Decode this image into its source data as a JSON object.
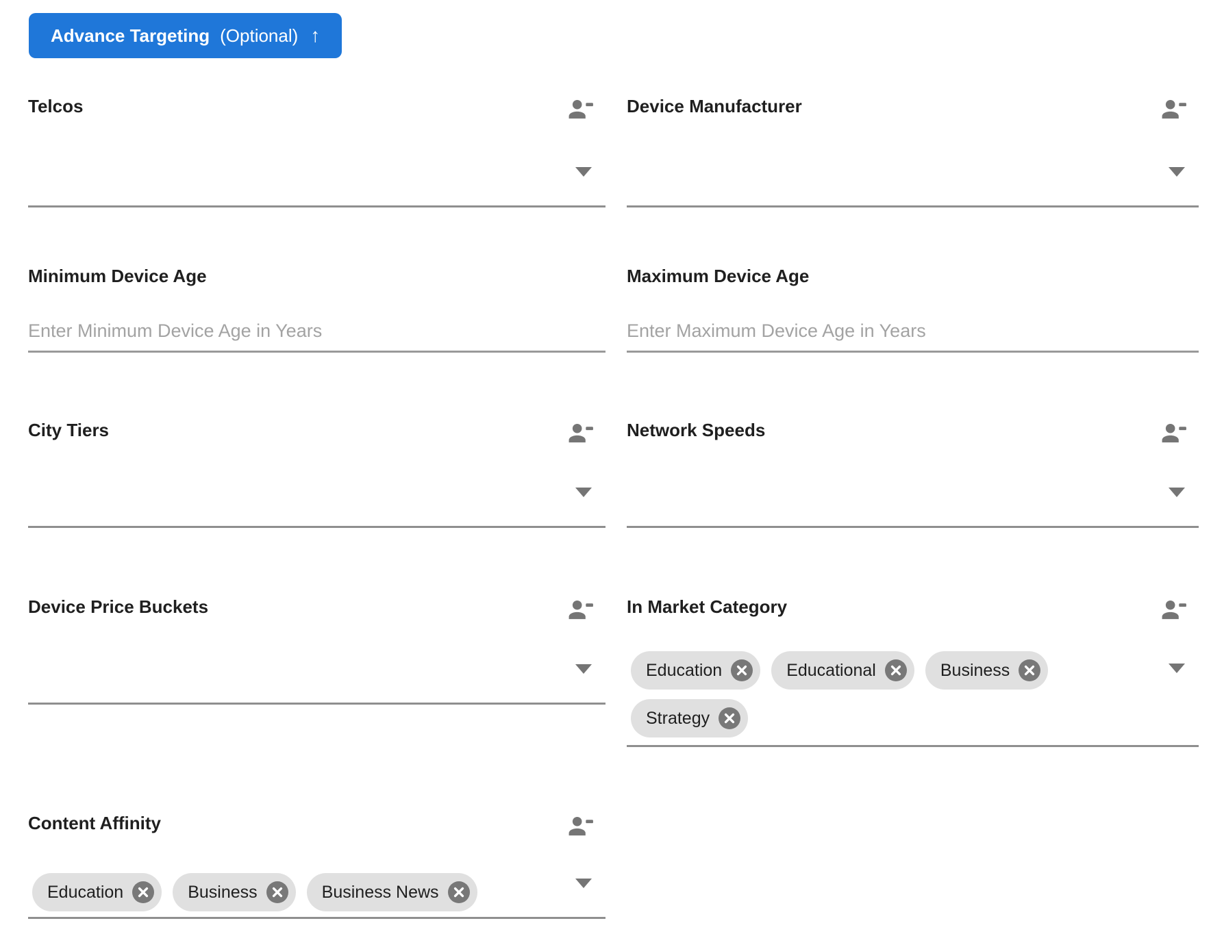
{
  "button": {
    "label_primary": "Advance Targeting",
    "label_secondary": "(Optional)",
    "arrow_icon": "↑"
  },
  "fields": {
    "telcos": {
      "label": "Telcos"
    },
    "device_manufacturer": {
      "label": "Device Manufacturer"
    },
    "min_device_age": {
      "label": "Minimum Device Age",
      "placeholder": "Enter Minimum Device Age in Years",
      "value": ""
    },
    "max_device_age": {
      "label": "Maximum Device Age",
      "placeholder": "Enter Maximum Device Age in Years",
      "value": ""
    },
    "city_tiers": {
      "label": "City Tiers"
    },
    "network_speeds": {
      "label": "Network Speeds"
    },
    "device_price_buckets": {
      "label": "Device Price Buckets"
    },
    "in_market_category": {
      "label": "In Market Category",
      "chips": [
        "Education",
        "Educational",
        "Business",
        "Strategy"
      ]
    },
    "content_affinity": {
      "label": "Content Affinity",
      "chips": [
        "Education",
        "Business",
        "Business News"
      ]
    }
  },
  "colors": {
    "accent_blue": "#1F77D9",
    "chip_bg": "#E0E0E0",
    "chip_delete_bg": "#787878",
    "icon_gray": "#757575",
    "underline": "#8F8F8F",
    "label_text": "#1F1F1F",
    "placeholder": "#A3A3A3"
  }
}
